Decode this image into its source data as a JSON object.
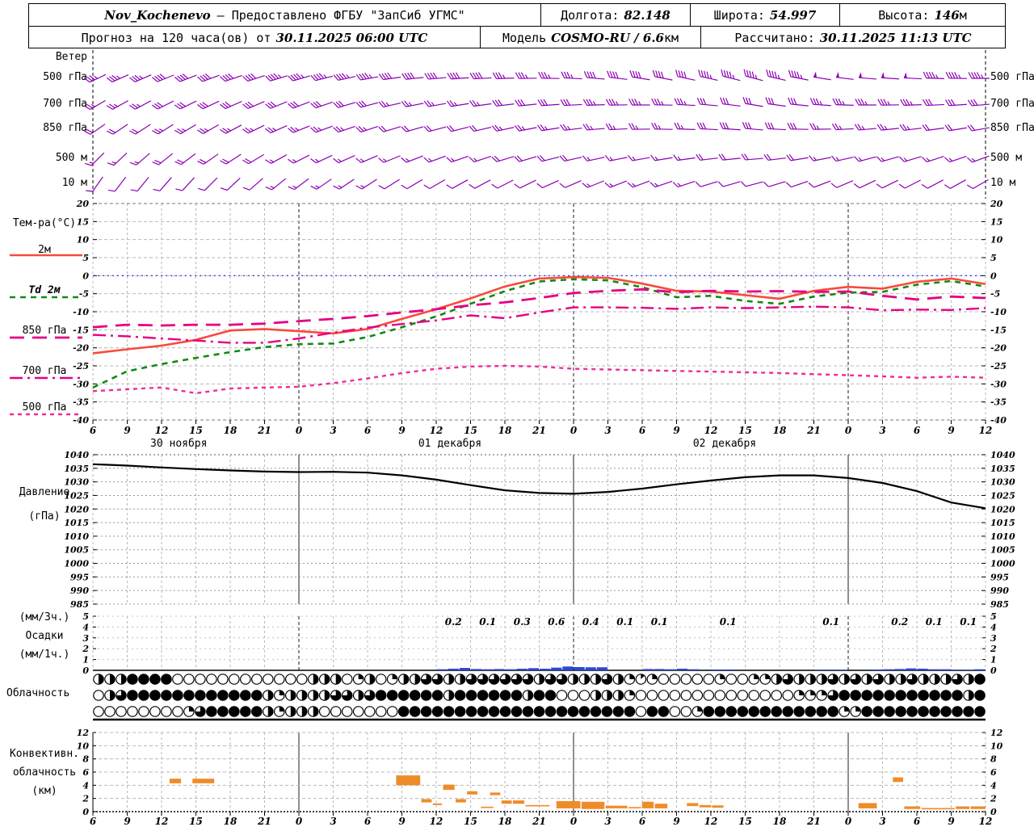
{
  "header": {
    "station": "Nov_Kochenevo",
    "provider": "– Предоставлено ФГБУ \"ЗапСиб УГМС\"",
    "lon_label": "Долгота:",
    "lon": "82.148",
    "lat_label": "Широта:",
    "lat": "54.997",
    "alt_label": "Высота:",
    "alt": "146",
    "alt_unit": "м",
    "forecast_label": "Прогноз на 120 часа(ов) от",
    "forecast_time": "30.11.2025 06:00 UTC",
    "model_label": "Модель",
    "model": "COSMO-RU / 6.6",
    "model_unit": "км",
    "calc_label": "Рассчитано:",
    "calc_time": "30.11.2025 11:13 UTC"
  },
  "panels": {
    "wind": {
      "title": "Ветер",
      "levels": [
        "500 гПа",
        "700 гПа",
        "850 гПа",
        "500 м",
        "10 м"
      ]
    },
    "temperature": {
      "title": "Тем-ра(°C)",
      "legend": [
        {
          "label": "2м"
        },
        {
          "label": "Td  2м"
        },
        {
          "label": "850 гПа"
        },
        {
          "label": "700 гПа"
        },
        {
          "label": "500 гПа"
        }
      ]
    },
    "pressure": {
      "line1": "Давление",
      "line2": "(гПа)"
    },
    "precip": {
      "line1": "(мм/3ч.)",
      "line2": "Осадки",
      "line3": "(мм/1ч.)"
    },
    "cloud": {
      "title": "Облачность"
    },
    "convective": {
      "line1": "Конвективн.",
      "line2": "облачность",
      "line3": "(км)"
    }
  },
  "colors": {
    "barb": "#8b00b3",
    "t2m": "#f9493b",
    "td2m": "#118a11",
    "t850": "#e60082",
    "t700": "#e60082",
    "t500": "#ee2d96",
    "zero_line": "#2222ff",
    "pressure": "#000000",
    "precip_bar": "#2b46d9",
    "conv_bar": "#ef8c2a"
  },
  "chart_data": {
    "type": "meteogram",
    "x_axis": {
      "hour_labels": [
        "6",
        "9",
        "12",
        "15",
        "18",
        "21",
        "0",
        "3",
        "6",
        "9",
        "12",
        "15",
        "18",
        "21",
        "0",
        "3",
        "6",
        "9",
        "12",
        "15",
        "18",
        "21",
        "0",
        "3",
        "6",
        "9",
        "12"
      ],
      "dates": [
        {
          "label": "30 ноября",
          "tick": 2.5
        },
        {
          "label": "01 декабря",
          "tick": 10.4
        },
        {
          "label": "02 декабря",
          "tick": 18.4
        }
      ],
      "hours_span": 78
    },
    "wind": {
      "rows": [
        {
          "name": "500 гПа",
          "control": [
            [
              245,
              35
            ],
            [
              250,
              40
            ],
            [
              255,
              45
            ],
            [
              265,
              40
            ],
            [
              270,
              35
            ],
            [
              280,
              40
            ],
            [
              285,
              45
            ],
            [
              275,
              50
            ],
            [
              270,
              45
            ]
          ]
        },
        {
          "name": "700 гПа",
          "control": [
            [
              240,
              25
            ],
            [
              245,
              30
            ],
            [
              250,
              30
            ],
            [
              260,
              25
            ],
            [
              265,
              30
            ],
            [
              270,
              35
            ],
            [
              280,
              30
            ],
            [
              270,
              35
            ],
            [
              265,
              30
            ]
          ]
        },
        {
          "name": "850 гПа",
          "control": [
            [
              235,
              20
            ],
            [
              240,
              25
            ],
            [
              250,
              25
            ],
            [
              255,
              20
            ],
            [
              260,
              25
            ],
            [
              270,
              25
            ],
            [
              275,
              30
            ],
            [
              265,
              25
            ],
            [
              260,
              20
            ]
          ]
        },
        {
          "name": "500 м",
          "control": [
            [
              225,
              15
            ],
            [
              235,
              20
            ],
            [
              245,
              15
            ],
            [
              250,
              15
            ],
            [
              255,
              20
            ],
            [
              260,
              15
            ],
            [
              265,
              20
            ],
            [
              255,
              15
            ],
            [
              250,
              15
            ]
          ]
        },
        {
          "name": "10 м",
          "control": [
            [
              215,
              10
            ],
            [
              225,
              10
            ],
            [
              235,
              15
            ],
            [
              240,
              10
            ],
            [
              245,
              10
            ],
            [
              250,
              15
            ],
            [
              255,
              10
            ],
            [
              245,
              10
            ],
            [
              240,
              10
            ]
          ]
        }
      ]
    },
    "temperature": {
      "ylim": [
        -40,
        20
      ],
      "grid_step": 5,
      "ticks": [
        20,
        15,
        10,
        5,
        0,
        -5,
        -10,
        -15,
        -20,
        -25,
        -30,
        -35,
        -40
      ],
      "series": [
        {
          "name": "2м",
          "values": [
            -21.5,
            -20.4,
            -19.4,
            -17.8,
            -15.2,
            -14.8,
            -15.4,
            -16.0,
            -14.8,
            -12.0,
            -9.3,
            -6.3,
            -3.0,
            -0.8,
            -0.4,
            -0.6,
            -2.2,
            -4.2,
            -4.4,
            -5.4,
            -6.4,
            -4.2,
            -3.1,
            -3.6,
            -1.7,
            -0.8,
            -2.3
          ]
        },
        {
          "name": "Td 2м",
          "values": [
            -31.0,
            -26.5,
            -24.5,
            -22.8,
            -21.2,
            -19.8,
            -19.0,
            -18.8,
            -17.0,
            -14.3,
            -11.3,
            -7.8,
            -4.3,
            -1.6,
            -1.0,
            -1.3,
            -3.2,
            -6.0,
            -5.6,
            -7.0,
            -7.8,
            -5.8,
            -4.7,
            -4.5,
            -2.5,
            -1.5,
            -3.0
          ]
        },
        {
          "name": "850 гПа",
          "values": [
            -14.3,
            -13.6,
            -13.8,
            -13.6,
            -13.6,
            -13.3,
            -12.6,
            -12.0,
            -11.2,
            -10.2,
            -9.3,
            -8.2,
            -7.4,
            -6.2,
            -4.8,
            -4.2,
            -3.8,
            -4.6,
            -4.2,
            -4.4,
            -4.3,
            -4.5,
            -4.4,
            -5.6,
            -6.6,
            -5.8,
            -6.2
          ]
        },
        {
          "name": "700 гПа",
          "values": [
            -16.4,
            -16.8,
            -17.4,
            -18.0,
            -18.6,
            -18.6,
            -17.4,
            -15.8,
            -14.4,
            -13.4,
            -12.4,
            -11.0,
            -11.8,
            -10.2,
            -8.8,
            -8.8,
            -8.9,
            -9.2,
            -8.8,
            -9.0,
            -8.8,
            -8.6,
            -8.8,
            -9.6,
            -9.4,
            -9.5,
            -9.0
          ]
        },
        {
          "name": "500 гПа",
          "values": [
            -32.0,
            -31.5,
            -31.0,
            -32.6,
            -31.3,
            -31.0,
            -30.8,
            -29.8,
            -28.5,
            -27.0,
            -25.8,
            -25.2,
            -25.0,
            -25.2,
            -25.8,
            -26.0,
            -26.2,
            -26.4,
            -26.6,
            -26.8,
            -27.0,
            -27.3,
            -27.6,
            -27.9,
            -28.3,
            -28.0,
            -28.3
          ]
        }
      ]
    },
    "pressure": {
      "ylim": [
        985,
        1040
      ],
      "ticks": [
        1040,
        1035,
        1030,
        1025,
        1020,
        1015,
        1010,
        1005,
        1000,
        995,
        990,
        985
      ],
      "values": [
        1036.5,
        1036.0,
        1035.3,
        1034.7,
        1034.2,
        1033.8,
        1033.6,
        1033.7,
        1033.4,
        1032.4,
        1030.8,
        1028.8,
        1026.9,
        1025.9,
        1025.6,
        1026.3,
        1027.5,
        1029.1,
        1030.5,
        1031.7,
        1032.4,
        1032.4,
        1031.4,
        1029.6,
        1026.6,
        1022.4,
        1020.3
      ]
    },
    "precip": {
      "ticks": [
        5,
        4,
        3,
        2,
        1,
        0
      ],
      "labels_3h": [
        {
          "slot": 10,
          "value": "0.2"
        },
        {
          "slot": 11,
          "value": "0.1"
        },
        {
          "slot": 12,
          "value": "0.3"
        },
        {
          "slot": 13,
          "value": "0.6"
        },
        {
          "slot": 14,
          "value": "0.4"
        },
        {
          "slot": 15,
          "value": "0.1"
        },
        {
          "slot": 16,
          "value": "0.1"
        },
        {
          "slot": 18,
          "value": "0.1"
        },
        {
          "slot": 21,
          "value": "0.1"
        },
        {
          "slot": 23,
          "value": "0.2"
        },
        {
          "slot": 24,
          "value": "0.1"
        },
        {
          "slot": 25,
          "value": "0.1"
        }
      ],
      "hourly": [
        0,
        0,
        0,
        0,
        0,
        0,
        0,
        0,
        0,
        0,
        0,
        0,
        0,
        0,
        0,
        0,
        0,
        0,
        0,
        0,
        0,
        0,
        0,
        0,
        0,
        0,
        0,
        0,
        0,
        0,
        0.1,
        0.15,
        0.22,
        0.12,
        0.1,
        0.12,
        0.1,
        0.15,
        0.2,
        0.15,
        0.25,
        0.35,
        0.3,
        0.28,
        0.28,
        0,
        0,
        0,
        0.12,
        0.12,
        0.1,
        0.15,
        0.1,
        0,
        0.08,
        0.08,
        0,
        0,
        0,
        0,
        0,
        0,
        0,
        0.05,
        0.05,
        0.05,
        0,
        0,
        0.08,
        0.1,
        0.12,
        0.18,
        0.15,
        0.1,
        0.1,
        0.06,
        0.05,
        0.1
      ]
    },
    "cloud": {
      "rows": [
        [
          4,
          4,
          4,
          8,
          8,
          8,
          8,
          0,
          0,
          0,
          0,
          0,
          0,
          0,
          0,
          0,
          0,
          0,
          0,
          4,
          4,
          4,
          0,
          2,
          4,
          0,
          2,
          4,
          4,
          6,
          6,
          4,
          4,
          6,
          6,
          6,
          6,
          6,
          6,
          4,
          6,
          6,
          4,
          4,
          4,
          6,
          4,
          2,
          1,
          2,
          0,
          0,
          0,
          0,
          0,
          2,
          0,
          0,
          2,
          2,
          4,
          6,
          4,
          4,
          4,
          6,
          4,
          6,
          4,
          6,
          4,
          4,
          6,
          4,
          4,
          4,
          6,
          4,
          8
        ],
        [
          0,
          4,
          6,
          8,
          8,
          8,
          8,
          8,
          8,
          8,
          8,
          8,
          8,
          8,
          8,
          4,
          2,
          4,
          4,
          4,
          4,
          6,
          6,
          4,
          6,
          8,
          8,
          8,
          8,
          8,
          8,
          4,
          8,
          8,
          8,
          8,
          8,
          8,
          4,
          8,
          8,
          0,
          0,
          0,
          4,
          4,
          4,
          2,
          0,
          0,
          0,
          0,
          0,
          0,
          0,
          0,
          0,
          0,
          0,
          0,
          0,
          0,
          2,
          2,
          2,
          6,
          8,
          8,
          8,
          8,
          8,
          8,
          8,
          8,
          8,
          8,
          8,
          4,
          8
        ],
        [
          0,
          0,
          0,
          0,
          0,
          0,
          0,
          0,
          2,
          6,
          8,
          8,
          8,
          8,
          8,
          4,
          2,
          4,
          4,
          4,
          0,
          0,
          0,
          0,
          0,
          0,
          0,
          8,
          8,
          8,
          8,
          8,
          8,
          8,
          8,
          8,
          8,
          8,
          8,
          8,
          8,
          8,
          8,
          8,
          8,
          8,
          8,
          8,
          0,
          8,
          8,
          0,
          0,
          2,
          8,
          8,
          8,
          8,
          8,
          8,
          8,
          8,
          8,
          8,
          8,
          8,
          2,
          2,
          8,
          8,
          8,
          8,
          8,
          8,
          8,
          8,
          8,
          8,
          8
        ]
      ]
    },
    "convective": {
      "ylim": [
        0,
        12
      ],
      "ticks": [
        12,
        10,
        8,
        6,
        4,
        2,
        0
      ],
      "bars": [
        [
          6.7,
          7.7,
          4.3,
          5.0
        ],
        [
          8.7,
          10.6,
          4.3,
          5.0
        ],
        [
          26.5,
          28.6,
          4.0,
          5.5
        ],
        [
          28.7,
          29.6,
          1.4,
          1.9
        ],
        [
          29.7,
          30.5,
          1.0,
          1.25
        ],
        [
          30.6,
          31.6,
          3.3,
          4.1
        ],
        [
          31.7,
          32.6,
          1.4,
          1.9
        ],
        [
          32.7,
          33.6,
          2.6,
          3.1
        ],
        [
          33.9,
          35.0,
          0.55,
          0.75
        ],
        [
          34.7,
          35.6,
          2.5,
          2.9
        ],
        [
          35.7,
          36.6,
          1.2,
          1.7
        ],
        [
          36.7,
          37.7,
          1.2,
          1.7
        ],
        [
          37.8,
          39.9,
          0.8,
          1.0
        ],
        [
          40.5,
          42.6,
          0.5,
          1.6
        ],
        [
          42.7,
          44.7,
          0.4,
          1.5
        ],
        [
          44.8,
          46.7,
          0.5,
          0.9
        ],
        [
          46.8,
          47.9,
          0.5,
          0.7
        ],
        [
          48.0,
          49.0,
          0.5,
          1.5
        ],
        [
          49.1,
          50.2,
          0.5,
          1.2
        ],
        [
          51.9,
          52.9,
          0.85,
          1.3
        ],
        [
          53.0,
          54.0,
          0.65,
          1.0
        ],
        [
          54.1,
          55.1,
          0.6,
          0.95
        ],
        [
          66.9,
          68.5,
          0.5,
          1.3
        ],
        [
          69.9,
          70.8,
          4.5,
          5.2
        ],
        [
          70.9,
          72.3,
          0.4,
          0.8
        ],
        [
          72.4,
          75.3,
          0.35,
          0.55
        ],
        [
          75.4,
          76.6,
          0.4,
          0.8
        ],
        [
          76.7,
          78.0,
          0.4,
          0.8
        ]
      ]
    }
  }
}
